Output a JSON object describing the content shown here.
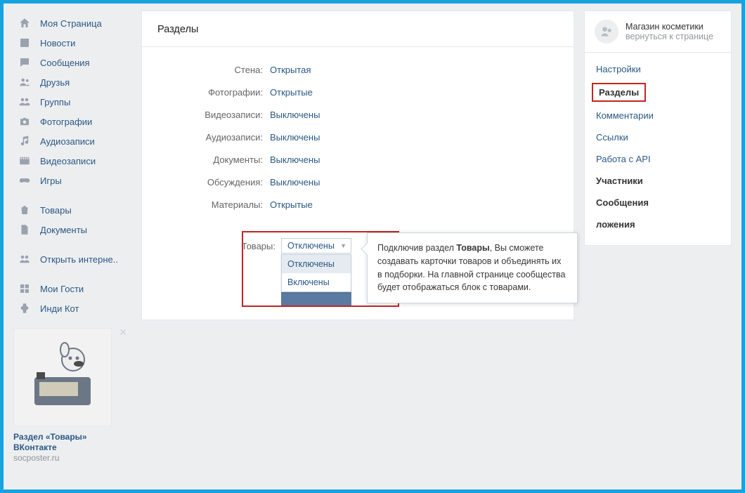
{
  "leftnav": {
    "items1": [
      {
        "icon": "home",
        "label": "Моя Страница"
      },
      {
        "icon": "news",
        "label": "Новости"
      },
      {
        "icon": "msg",
        "label": "Сообщения"
      },
      {
        "icon": "friends",
        "label": "Друзья"
      },
      {
        "icon": "groups",
        "label": "Группы"
      },
      {
        "icon": "photo",
        "label": "Фотографии"
      },
      {
        "icon": "audio",
        "label": "Аудиозаписи"
      },
      {
        "icon": "video",
        "label": "Видеозаписи"
      },
      {
        "icon": "games",
        "label": "Игры"
      }
    ],
    "items2": [
      {
        "icon": "bag",
        "label": "Товары"
      },
      {
        "icon": "docs",
        "label": "Документы"
      }
    ],
    "items3": [
      {
        "icon": "internet",
        "label": "Открыть интерне.."
      }
    ],
    "items4": [
      {
        "icon": "guests",
        "label": "Мои Гости"
      },
      {
        "icon": "indy",
        "label": "Инди Кот"
      }
    ]
  },
  "promo": {
    "title_l1": "Раздел «Товары»",
    "title_l2": "ВКонтакте",
    "source": "socposter.ru"
  },
  "main": {
    "title": "Разделы",
    "rows": [
      {
        "label": "Стена:",
        "value": "Открытая"
      },
      {
        "label": "Фотографии:",
        "value": "Открытые"
      },
      {
        "label": "Видеозаписи:",
        "value": "Выключены"
      },
      {
        "label": "Аудиозаписи:",
        "value": "Выключены"
      },
      {
        "label": "Документы:",
        "value": "Выключены"
      },
      {
        "label": "Обсуждения:",
        "value": "Выключены"
      },
      {
        "label": "Материалы:",
        "value": "Открытые"
      }
    ],
    "products": {
      "label": "Товары:",
      "selected": "Отключены",
      "options": [
        "Отключены",
        "Включены"
      ]
    },
    "tooltip": {
      "pre": "Подключив раздел ",
      "bold": "Товары",
      "post": ", Вы сможете создавать карточки товаров и объединять их в подборки. На главной странице сообщества будет отображаться блок с товарами."
    }
  },
  "right": {
    "head": {
      "title": "Магазин косметики",
      "sub": "вернуться к странице"
    },
    "nav": {
      "settings": "Настройки",
      "sections": "Разделы",
      "comments": "Комментарии",
      "links": "Ссылки",
      "api": "Работа с API",
      "members": "Участники",
      "messages": "Сообщения",
      "apps_partial": "ложения"
    }
  }
}
